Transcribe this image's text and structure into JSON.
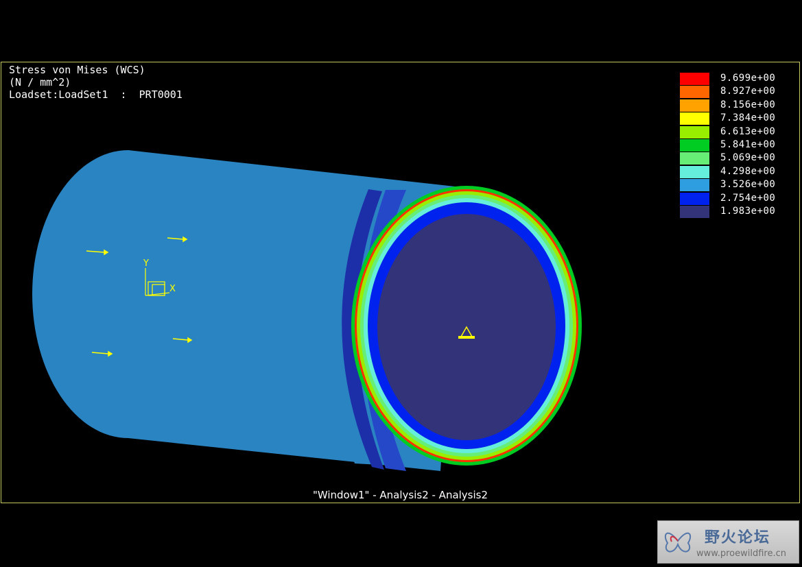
{
  "header": {
    "line1": "Stress von Mises (WCS)",
    "line2": "(N / mm^2)",
    "line3": "Loadset:LoadSet1  :  PRT0001"
  },
  "legend": {
    "items": [
      {
        "value": "9.699e+00",
        "color": "#ff0000"
      },
      {
        "value": "8.927e+00",
        "color": "#ff6600"
      },
      {
        "value": "8.156e+00",
        "color": "#ffa200"
      },
      {
        "value": "7.384e+00",
        "color": "#ffff00"
      },
      {
        "value": "6.613e+00",
        "color": "#99ee00"
      },
      {
        "value": "5.841e+00",
        "color": "#00cc22"
      },
      {
        "value": "5.069e+00",
        "color": "#66ee77"
      },
      {
        "value": "4.298e+00",
        "color": "#66eedd"
      },
      {
        "value": "3.526e+00",
        "color": "#2e9ee0"
      },
      {
        "value": "2.754e+00",
        "color": "#0022ee"
      },
      {
        "value": "1.983e+00",
        "color": "#33337a"
      }
    ]
  },
  "coord_system": {
    "y_label": "Y",
    "x_label": "X"
  },
  "window_caption": "\"Window1\"  -  Analysis2  -  Analysis2",
  "watermark": {
    "title": "野火论坛",
    "url": "www.proewildfire.cn"
  }
}
